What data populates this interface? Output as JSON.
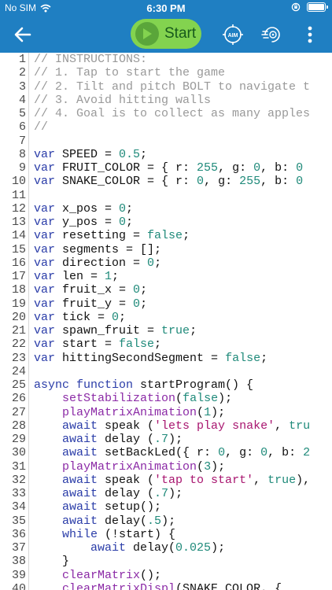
{
  "status": {
    "carrier": "No SIM",
    "time": "6:30 PM"
  },
  "toolbar": {
    "start_label": "Start",
    "aim_label": "AIM"
  },
  "code": [
    [
      [
        "c",
        "// INSTRUCTIONS:"
      ]
    ],
    [
      [
        "c",
        "// 1. Tap to start the game"
      ]
    ],
    [
      [
        "c",
        "// 2. Tilt and pitch BOLT to navigate t"
      ]
    ],
    [
      [
        "c",
        "// 3. Avoid hitting walls"
      ]
    ],
    [
      [
        "c",
        "// 4. Goal is to collect as many apples"
      ]
    ],
    [
      [
        "c",
        "//"
      ]
    ],
    [],
    [
      [
        "k",
        "var"
      ],
      [
        "t",
        " SPEED = "
      ],
      [
        "n",
        "0.5"
      ],
      [
        "t",
        ";"
      ]
    ],
    [
      [
        "k",
        "var"
      ],
      [
        "t",
        " FRUIT_COLOR = { r: "
      ],
      [
        "n",
        "255"
      ],
      [
        "t",
        ", g: "
      ],
      [
        "n",
        "0"
      ],
      [
        "t",
        ", b: "
      ],
      [
        "n",
        "0"
      ]
    ],
    [
      [
        "k",
        "var"
      ],
      [
        "t",
        " SNAKE_COLOR = { r: "
      ],
      [
        "n",
        "0"
      ],
      [
        "t",
        ", g: "
      ],
      [
        "n",
        "255"
      ],
      [
        "t",
        ", b: "
      ],
      [
        "n",
        "0"
      ]
    ],
    [],
    [
      [
        "k",
        "var"
      ],
      [
        "t",
        " x_pos = "
      ],
      [
        "n",
        "0"
      ],
      [
        "t",
        ";"
      ]
    ],
    [
      [
        "k",
        "var"
      ],
      [
        "t",
        " y_pos = "
      ],
      [
        "n",
        "0"
      ],
      [
        "t",
        ";"
      ]
    ],
    [
      [
        "k",
        "var"
      ],
      [
        "t",
        " resetting = "
      ],
      [
        "n",
        "false"
      ],
      [
        "t",
        ";"
      ]
    ],
    [
      [
        "k",
        "var"
      ],
      [
        "t",
        " segments = [];"
      ]
    ],
    [
      [
        "k",
        "var"
      ],
      [
        "t",
        " direction = "
      ],
      [
        "n",
        "0"
      ],
      [
        "t",
        ";"
      ]
    ],
    [
      [
        "k",
        "var"
      ],
      [
        "t",
        " len = "
      ],
      [
        "n",
        "1"
      ],
      [
        "t",
        ";"
      ]
    ],
    [
      [
        "k",
        "var"
      ],
      [
        "t",
        " fruit_x = "
      ],
      [
        "n",
        "0"
      ],
      [
        "t",
        ";"
      ]
    ],
    [
      [
        "k",
        "var"
      ],
      [
        "t",
        " fruit_y = "
      ],
      [
        "n",
        "0"
      ],
      [
        "t",
        ";"
      ]
    ],
    [
      [
        "k",
        "var"
      ],
      [
        "t",
        " tick = "
      ],
      [
        "n",
        "0"
      ],
      [
        "t",
        ";"
      ]
    ],
    [
      [
        "k",
        "var"
      ],
      [
        "t",
        " spawn_fruit = "
      ],
      [
        "n",
        "true"
      ],
      [
        "t",
        ";"
      ]
    ],
    [
      [
        "k",
        "var"
      ],
      [
        "t",
        " start = "
      ],
      [
        "n",
        "false"
      ],
      [
        "t",
        ";"
      ]
    ],
    [
      [
        "k",
        "var"
      ],
      [
        "t",
        " hittingSecondSegment = "
      ],
      [
        "n",
        "false"
      ],
      [
        "t",
        ";"
      ]
    ],
    [],
    [
      [
        "k",
        "async function"
      ],
      [
        "t",
        " startProgram() {"
      ]
    ],
    [
      [
        "t",
        "    "
      ],
      [
        "f",
        "setStabilization"
      ],
      [
        "t",
        "("
      ],
      [
        "n",
        "false"
      ],
      [
        "t",
        ");"
      ]
    ],
    [
      [
        "t",
        "    "
      ],
      [
        "f",
        "playMatrixAnimation"
      ],
      [
        "t",
        "("
      ],
      [
        "n",
        "1"
      ],
      [
        "t",
        ");"
      ]
    ],
    [
      [
        "t",
        "    "
      ],
      [
        "k",
        "await"
      ],
      [
        "t",
        " speak ("
      ],
      [
        "s",
        "'lets play snake'"
      ],
      [
        "t",
        ", "
      ],
      [
        "n",
        "tru"
      ]
    ],
    [
      [
        "t",
        "    "
      ],
      [
        "k",
        "await"
      ],
      [
        "t",
        " delay ("
      ],
      [
        "n",
        ".7"
      ],
      [
        "t",
        ");"
      ]
    ],
    [
      [
        "t",
        "    "
      ],
      [
        "k",
        "await"
      ],
      [
        "t",
        " setBackLed({ r: "
      ],
      [
        "n",
        "0"
      ],
      [
        "t",
        ", g: "
      ],
      [
        "n",
        "0"
      ],
      [
        "t",
        ", b: "
      ],
      [
        "n",
        "2"
      ]
    ],
    [
      [
        "t",
        "    "
      ],
      [
        "f",
        "playMatrixAnimation"
      ],
      [
        "t",
        "("
      ],
      [
        "n",
        "3"
      ],
      [
        "t",
        ");"
      ]
    ],
    [
      [
        "t",
        "    "
      ],
      [
        "k",
        "await"
      ],
      [
        "t",
        " speak ("
      ],
      [
        "s",
        "'tap to start'"
      ],
      [
        "t",
        ", "
      ],
      [
        "n",
        "true"
      ],
      [
        "t",
        "),"
      ]
    ],
    [
      [
        "t",
        "    "
      ],
      [
        "k",
        "await"
      ],
      [
        "t",
        " delay ("
      ],
      [
        "n",
        ".7"
      ],
      [
        "t",
        ");"
      ]
    ],
    [
      [
        "t",
        "    "
      ],
      [
        "k",
        "await"
      ],
      [
        "t",
        " setup();"
      ]
    ],
    [
      [
        "t",
        "    "
      ],
      [
        "k",
        "await"
      ],
      [
        "t",
        " delay("
      ],
      [
        "n",
        ".5"
      ],
      [
        "t",
        ");"
      ]
    ],
    [
      [
        "t",
        "    "
      ],
      [
        "k",
        "while"
      ],
      [
        "t",
        " (!start) {"
      ]
    ],
    [
      [
        "t",
        "        "
      ],
      [
        "k",
        "await"
      ],
      [
        "t",
        " delay("
      ],
      [
        "n",
        "0.025"
      ],
      [
        "t",
        ");"
      ]
    ],
    [
      [
        "t",
        "    }"
      ]
    ],
    [
      [
        "t",
        "    "
      ],
      [
        "f",
        "clearMatrix"
      ],
      [
        "t",
        "();"
      ]
    ],
    [
      [
        "t",
        "    "
      ],
      [
        "f",
        "clearMatrixDispl"
      ],
      [
        "t",
        "(SNAKE_COLOR, {"
      ]
    ]
  ]
}
